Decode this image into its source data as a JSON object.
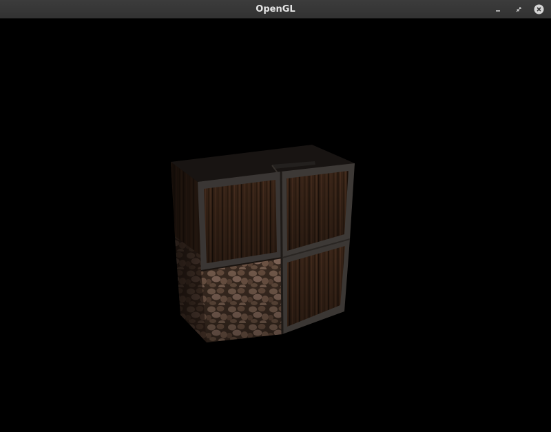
{
  "window": {
    "title": "OpenGL",
    "controls": [
      "minimize-icon",
      "restore-icon",
      "close-icon"
    ]
  },
  "viewport": {
    "background_color": "#000000",
    "scene": {
      "objects": [
        {
          "name": "wooden-crate-top-left",
          "texture": "wood-crate"
        },
        {
          "name": "wooden-crate-top-right",
          "texture": "wood-crate"
        },
        {
          "name": "stone-block-bottom-left",
          "texture": "cobblestone"
        },
        {
          "name": "wooden-crate-bottom-right",
          "texture": "wood-crate"
        }
      ]
    }
  },
  "colors": {
    "titlebar": "#363636",
    "title_text": "#e6e6e6",
    "close_button": "#d5d5d5",
    "wood_dark": "#2a1b12",
    "wood_mid": "#4a3020",
    "stone": "#6a5242",
    "metal_frame": "#3a3836"
  }
}
